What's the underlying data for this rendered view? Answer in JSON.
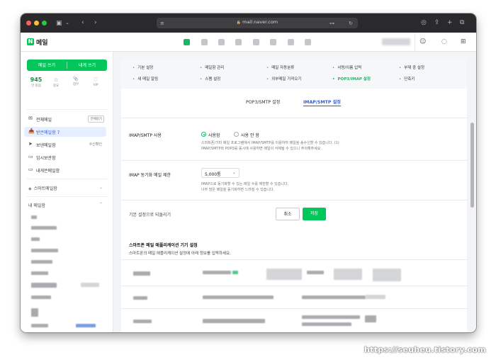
{
  "browser": {
    "url": "mail.naver.com",
    "dot_colors": [
      "#ff5f57",
      "#febc2e",
      "#28c840"
    ]
  },
  "app": {
    "logo_letter": "N",
    "title": "메일"
  },
  "sidebar": {
    "write_button": "메일 쓰기",
    "write_to_me_button": "내게 쓰기",
    "counts": [
      {
        "value": "945",
        "label": "안 읽음"
      },
      {
        "value": "☆",
        "label": "중요"
      },
      {
        "value": "📎",
        "label": "첨부"
      },
      {
        "value": "♡",
        "label": "VIP"
      }
    ],
    "items": [
      {
        "icon": "✉",
        "label": "전체메일",
        "extra": "전체읽기"
      },
      {
        "icon": "📥",
        "label": "받은메일함 7",
        "extra": ""
      },
      {
        "icon": "➤",
        "label": "보낸메일함",
        "extra": "수신확인"
      },
      {
        "icon": "▭",
        "label": "임시보관함",
        "extra": ""
      },
      {
        "icon": "▭",
        "label": "내게쓴메일함",
        "extra": ""
      }
    ],
    "smart_mailbox": "스마트메일함",
    "my_mailbox": "내 메일함"
  },
  "settings_nav": {
    "col1": [
      "기본 설정",
      "새 메일 알림"
    ],
    "col2": [
      "메일함 관리",
      "스팸 설정"
    ],
    "col3": [
      "메일 자동분류",
      "외부메일 가져오기"
    ],
    "col4": [
      "서명/이름 입력",
      "POP3/IMAP 설정"
    ],
    "col5": [
      "부재 중 설정",
      "단축키"
    ],
    "active": "POP3/IMAP 설정"
  },
  "tabs": [
    "POP3/SMTP 설정",
    "IMAP/SMTP 설정"
  ],
  "active_tab": "IMAP/SMTP 설정",
  "imap": {
    "label": "IMAP/SMTP 사용",
    "option_on": "사용함",
    "option_off": "사용 안 함",
    "selected": "사용함",
    "desc1": "스마트폰/기타 메일 프로그램에서 IMAP/SMTP를 이용하여 메일을 송수신할 수 있습니다. (1)",
    "desc2": "IMAP/SMTP와 POP3를 동시에 사용하면 메일이 삭제될 수 있으니 주의해주세요."
  },
  "limit": {
    "label": "IMAP 동기화 메일 제한",
    "value": "5,000통",
    "desc1": "IMAP으로 동기화할 수 있는 메일 수를 제한할 수 있습니다.",
    "desc2": "너무 많은 메일을 동기화하면 느려질 수 있습니다."
  },
  "reset_label": "기본 설정으로 되돌리기",
  "buttons": {
    "cancel": "취소",
    "save": "저장"
  },
  "app_section": {
    "title": "스마트폰 메일 애플리케이션 기기 설정",
    "subtitle": "스마트폰의 메일 애플리케이션 설정에 아래 정보를 입력하세요."
  },
  "watermark": "https://seuheu.tistory.com"
}
